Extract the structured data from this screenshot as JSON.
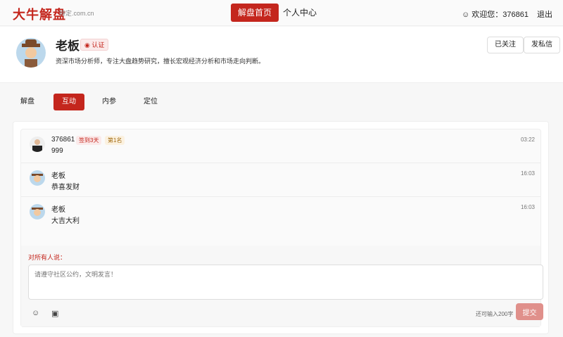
{
  "header": {
    "logo": "大牛解盘",
    "domain": "待定.com.cn",
    "nav": [
      "解盘首页",
      "个人中心"
    ],
    "welcome": "欢迎您：376861",
    "logout": "退出"
  },
  "profile": {
    "name": "老板",
    "badge": "认证",
    "bio": "资深市场分析师，专注大盘趋势研究，擅长宏观经济分析和市场走向判断。",
    "follow": "已关注",
    "message": "发私信"
  },
  "tabs": [
    "解盘",
    "互动",
    "内参",
    "定位"
  ],
  "messages": [
    {
      "name": "376861",
      "tags": [
        "签到3天",
        "第1名"
      ],
      "text": "999",
      "time": "03:22"
    },
    {
      "name": "老板",
      "text": "恭喜发财",
      "time": "16:03"
    },
    {
      "name": "老板",
      "text": "大吉大利",
      "time": "16:03"
    }
  ],
  "composer": {
    "label": "对所有人说：",
    "placeholder": "请遵守社区公约，文明发言！",
    "remaining": "还可输入200字",
    "submit": "提交"
  },
  "colors": {
    "brand": "#c4261d"
  }
}
